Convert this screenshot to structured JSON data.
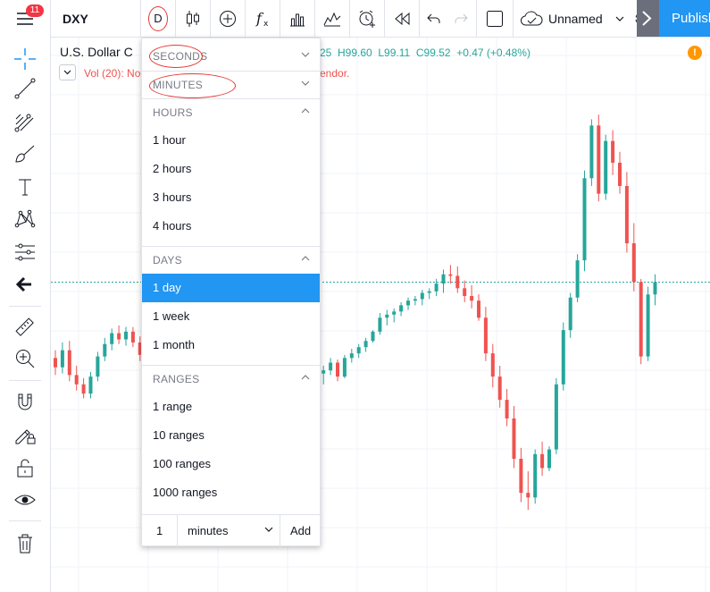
{
  "topbar": {
    "notification_count": "11",
    "symbol": "DXY",
    "interval": "D",
    "layout_name": "Unnamed",
    "publish_label": "Publish"
  },
  "legend": {
    "title": "U.S. Dollar C",
    "ohlc": "25  H99.60  L99.11  C99.52  +0.47 (+0.48%)",
    "vol_left": "Vol (20): No",
    "vol_right": "endor.",
    "warning": "!"
  },
  "colors": {
    "accent": "#2196f3",
    "up": "#26a69a",
    "down": "#ef5350",
    "annotation": "#e53935",
    "badge": "#f23645"
  },
  "dropdown": {
    "sections": [
      {
        "label": "SECONDS",
        "expanded": false,
        "items": []
      },
      {
        "label": "MINUTES",
        "expanded": false,
        "items": []
      },
      {
        "label": "HOURS",
        "expanded": true,
        "items": [
          "1 hour",
          "2 hours",
          "3 hours",
          "4 hours"
        ]
      },
      {
        "label": "DAYS",
        "expanded": true,
        "items": [
          "1 day",
          "1 week",
          "1 month"
        ]
      },
      {
        "label": "RANGES",
        "expanded": true,
        "items": [
          "1 range",
          "10 ranges",
          "100 ranges",
          "1000 ranges"
        ]
      }
    ],
    "selected_item": "1 day",
    "custom": {
      "count": "1",
      "unit": "minutes",
      "add_label": "Add"
    }
  },
  "left_toolbar_icons": [
    "crosshair-icon",
    "trend-line-icon",
    "fib-retracement-icon",
    "brush-icon",
    "text-icon",
    "pattern-icon",
    "prediction-icon",
    "back-arrow-icon",
    "ruler-icon",
    "zoom-in-icon",
    "magnet-icon",
    "lock-drawing-icon",
    "unlock-icon",
    "eye-icon",
    "trash-icon"
  ],
  "chart_data": {
    "type": "candlestick",
    "candles": [
      [
        102.5,
        103.0,
        101.4,
        101.9
      ],
      [
        101.9,
        103.5,
        101.5,
        103.0
      ],
      [
        103.0,
        103.6,
        101.0,
        101.4
      ],
      [
        101.4,
        102.0,
        100.4,
        100.8
      ],
      [
        100.8,
        101.2,
        99.9,
        100.2
      ],
      [
        100.2,
        101.6,
        99.9,
        101.3
      ],
      [
        101.3,
        102.9,
        101.0,
        102.6
      ],
      [
        102.6,
        103.8,
        102.3,
        103.4
      ],
      [
        103.4,
        104.4,
        103.0,
        104.1
      ],
      [
        104.1,
        104.6,
        103.4,
        103.7
      ],
      [
        103.7,
        104.5,
        103.3,
        104.2
      ],
      [
        104.2,
        104.5,
        103.2,
        103.5
      ],
      [
        103.5,
        103.9,
        102.3,
        102.7
      ],
      [
        102.7,
        103.0,
        101.6,
        102.0
      ],
      [
        102.0,
        102.5,
        100.9,
        101.2
      ],
      [
        101.2,
        101.8,
        100.5,
        101.0
      ],
      [
        101.0,
        101.4,
        99.6,
        99.9
      ],
      [
        99.9,
        100.6,
        99.2,
        100.2
      ],
      [
        100.2,
        100.5,
        98.9,
        99.3
      ],
      [
        99.3,
        99.9,
        98.6,
        99.0
      ],
      [
        99.0,
        99.4,
        97.7,
        98.2
      ],
      [
        98.2,
        98.8,
        97.2,
        97.6
      ],
      [
        97.6,
        97.9,
        96.5,
        96.9
      ],
      [
        96.9,
        98.1,
        96.6,
        97.9
      ],
      [
        97.9,
        99.5,
        97.7,
        99.3
      ],
      [
        99.3,
        100.9,
        99.1,
        100.8
      ],
      [
        100.8,
        101.7,
        100.5,
        101.4
      ],
      [
        101.4,
        101.6,
        100.7,
        101.1
      ],
      [
        101.1,
        101.6,
        100.6,
        101.3
      ],
      [
        101.3,
        101.5,
        100.1,
        100.5
      ],
      [
        100.5,
        101.1,
        99.9,
        100.8
      ],
      [
        100.8,
        101.7,
        100.5,
        101.4
      ],
      [
        101.4,
        101.7,
        100.8,
        101.1
      ],
      [
        101.1,
        101.5,
        100.8,
        101.2
      ],
      [
        101.2,
        101.9,
        100.7,
        101.6
      ],
      [
        101.6,
        101.9,
        101.1,
        101.4
      ],
      [
        101.4,
        102.3,
        101.1,
        102.1
      ],
      [
        102.1,
        102.3,
        101.2,
        101.5
      ],
      [
        101.5,
        102.0,
        100.8,
        101.7
      ],
      [
        101.7,
        102.5,
        101.4,
        102.2
      ],
      [
        102.2,
        102.4,
        101.0,
        101.3
      ],
      [
        101.3,
        102.7,
        101.2,
        102.5
      ],
      [
        102.5,
        103.1,
        102.2,
        102.8
      ],
      [
        102.8,
        103.4,
        102.5,
        103.2
      ],
      [
        103.2,
        103.8,
        102.9,
        103.6
      ],
      [
        103.6,
        104.3,
        103.5,
        104.2
      ],
      [
        104.2,
        105.4,
        104.0,
        105.1
      ],
      [
        105.1,
        105.6,
        104.6,
        105.3
      ],
      [
        105.3,
        105.7,
        104.8,
        105.5
      ],
      [
        105.5,
        106.1,
        105.2,
        105.9
      ],
      [
        105.9,
        106.4,
        105.6,
        106.2
      ],
      [
        106.2,
        106.5,
        105.9,
        106.3
      ],
      [
        106.3,
        106.9,
        105.9,
        106.7
      ],
      [
        106.7,
        107.0,
        106.3,
        106.8
      ],
      [
        106.8,
        107.6,
        106.5,
        107.3
      ],
      [
        107.3,
        108.2,
        106.7,
        107.9
      ],
      [
        107.9,
        108.5,
        107.3,
        107.8
      ],
      [
        107.8,
        108.4,
        106.7,
        107.0
      ],
      [
        107.0,
        107.5,
        106.1,
        106.5
      ],
      [
        106.5,
        107.2,
        105.7,
        106.2
      ],
      [
        106.2,
        106.6,
        104.9,
        105.1
      ],
      [
        105.1,
        105.8,
        102.3,
        102.8
      ],
      [
        102.8,
        103.4,
        100.6,
        101.3
      ],
      [
        101.3,
        102.0,
        99.3,
        99.8
      ],
      [
        99.8,
        100.5,
        98.1,
        98.6
      ],
      [
        98.6,
        99.4,
        95.4,
        96.0
      ],
      [
        96.0,
        96.7,
        93.2,
        93.8
      ],
      [
        93.8,
        95.2,
        92.7,
        93.5
      ],
      [
        93.5,
        96.6,
        93.1,
        96.3
      ],
      [
        96.3,
        97.1,
        94.9,
        95.4
      ],
      [
        95.4,
        96.8,
        95.2,
        96.6
      ],
      [
        96.6,
        101.2,
        96.3,
        100.8
      ],
      [
        100.8,
        104.8,
        100.4,
        104.3
      ],
      [
        104.3,
        106.7,
        103.8,
        106.4
      ],
      [
        106.4,
        109.2,
        106.1,
        108.8
      ],
      [
        108.8,
        114.6,
        108.1,
        114.1
      ],
      [
        114.1,
        117.9,
        113.6,
        117.5
      ],
      [
        117.5,
        118.2,
        112.6,
        113.1
      ],
      [
        113.1,
        116.9,
        112.7,
        116.5
      ],
      [
        116.5,
        117.2,
        114.3,
        115.1
      ],
      [
        115.1,
        115.8,
        113.1,
        113.6
      ],
      [
        113.6,
        114.5,
        109.3,
        109.9
      ],
      [
        109.9,
        111.2,
        106.8,
        107.4
      ],
      [
        107.4,
        107.6,
        102.1,
        102.6
      ],
      [
        102.6,
        107.1,
        102.3,
        106.6
      ],
      [
        106.6,
        107.9,
        105.9,
        107.4
      ]
    ]
  }
}
